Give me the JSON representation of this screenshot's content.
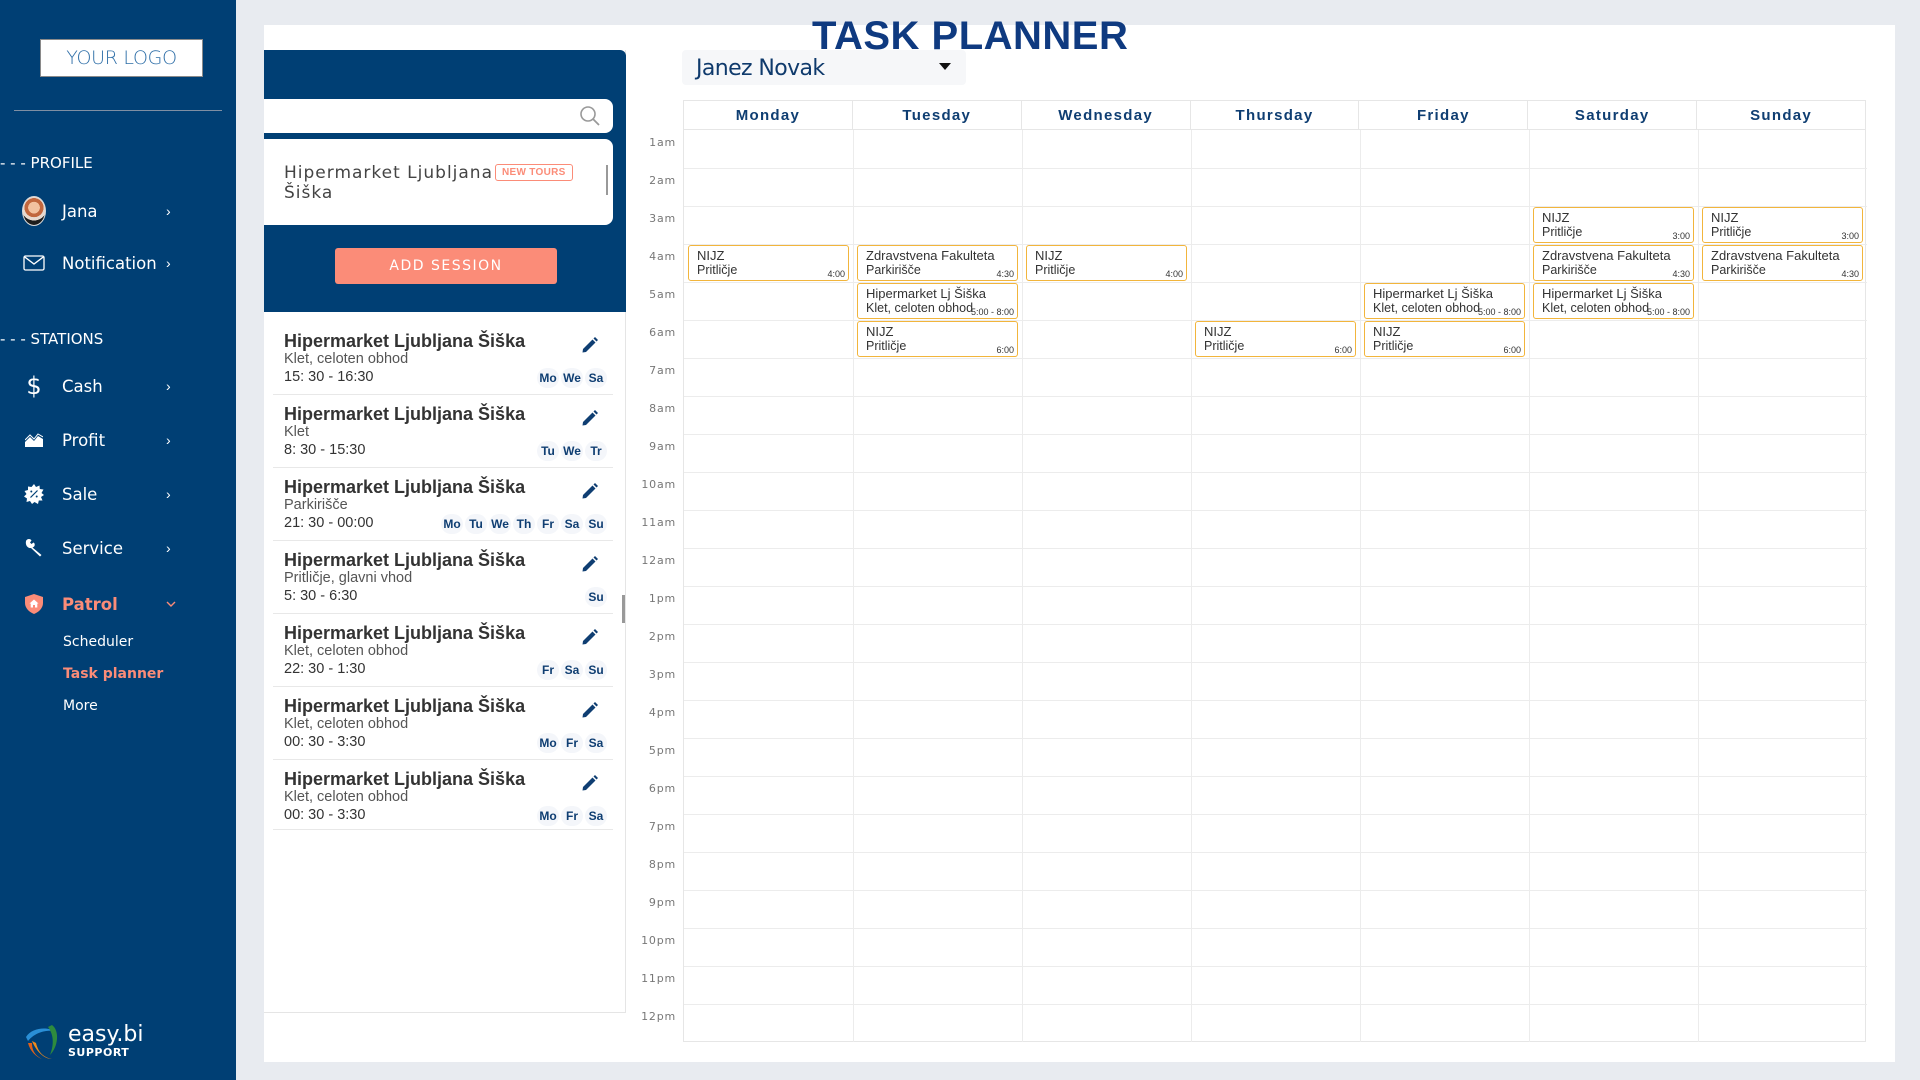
{
  "sidebar": {
    "logo": "YOUR LOGO",
    "profile_section": "- - -  PROFILE",
    "stations_section": "- - -  STATIONS",
    "profile_items": [
      {
        "label": "Jana",
        "icon": "avatar"
      },
      {
        "label": "Notification",
        "icon": "envelope-icon"
      }
    ],
    "station_items": [
      {
        "label": "Cash",
        "icon": "dollar-icon"
      },
      {
        "label": "Profit",
        "icon": "chart-area-icon"
      },
      {
        "label": "Sale",
        "icon": "sale-badge-icon"
      },
      {
        "label": "Service",
        "icon": "wrench-icon"
      },
      {
        "label": "Patrol",
        "icon": "shield-home-icon",
        "active": true
      }
    ],
    "patrol_sub": [
      {
        "label": "Scheduler"
      },
      {
        "label": "Task planner",
        "active": true
      },
      {
        "label": "More"
      }
    ],
    "brand": {
      "name": "easy.bi",
      "tag": "SUPPORT"
    },
    "chevron": "›",
    "chevron_down": "⌄"
  },
  "page": {
    "title": "TASK PLANNER",
    "accent_color": "#fb8c78",
    "primary_color": "#003f74"
  },
  "left_panel": {
    "search_placeholder": "",
    "location": {
      "name": "Hipermarket Ljubljana Šiška",
      "badge": "NEW TOURS"
    },
    "add_session_label": "ADD SESSION",
    "tasks": [
      {
        "title": "Hipermarket Ljubljana Šiška",
        "sub": "Klet, celoten obhod",
        "time": "15: 30 - 16:30",
        "days": [
          "Mo",
          "We",
          "Sa"
        ]
      },
      {
        "title": "Hipermarket Ljubljana Šiška",
        "sub": "Klet",
        "time": "8: 30 - 15:30",
        "days": [
          "Tu",
          "We",
          "Tr"
        ]
      },
      {
        "title": "Hipermarket Ljubljana Šiška",
        "sub": "Parkirišče",
        "time": "21: 30 - 00:00",
        "days": [
          "Mo",
          "Tu",
          "We",
          "Th",
          "Fr",
          "Sa",
          "Su"
        ]
      },
      {
        "title": "Hipermarket Ljubljana Šiška",
        "sub": "Pritličje, glavni vhod",
        "time": "5: 30 - 6:30",
        "days": [
          "Su"
        ]
      },
      {
        "title": "Hipermarket Ljubljana Šiška",
        "sub": "Klet, celoten obhod",
        "time": "22: 30 - 1:30",
        "days": [
          "Fr",
          "Sa",
          "Su"
        ]
      },
      {
        "title": "Hipermarket Ljubljana Šiška",
        "sub": "Klet, celoten obhod",
        "time": "00: 30 - 3:30",
        "days": [
          "Mo",
          "Fr",
          "Sa"
        ]
      },
      {
        "title": "Hipermarket Ljubljana Šiška",
        "sub": "Klet, celoten obhod",
        "time": "00: 30 - 3:30",
        "days": [
          "Mo",
          "Fr",
          "Sa"
        ]
      }
    ]
  },
  "calendar": {
    "user": "Janez Novak",
    "days": [
      "Monday",
      "Tuesday",
      "Wednesday",
      "Thursday",
      "Friday",
      "Saturday",
      "Sunday"
    ],
    "hours": [
      "1am",
      "2am",
      "3am",
      "4am",
      "5am",
      "6am",
      "7am",
      "8am",
      "9am",
      "10am",
      "11am",
      "12am",
      "1pm",
      "2pm",
      "3pm",
      "4pm",
      "5pm",
      "6pm",
      "7pm",
      "8pm",
      "9pm",
      "10pm",
      "11pm",
      "12pm"
    ],
    "events": [
      {
        "day": 0,
        "row": 3,
        "title": "NIJZ",
        "sub": "Pritličje",
        "time": "4:00"
      },
      {
        "day": 1,
        "row": 3,
        "title": "Zdravstvena Fakulteta",
        "sub": "Parkirišče",
        "time": "4:30"
      },
      {
        "day": 1,
        "row": 4,
        "title": "Hipermarket Lj Šiška",
        "sub": "Klet, celoten obhod",
        "time": "5:00 - 8:00"
      },
      {
        "day": 1,
        "row": 5,
        "title": "NIJZ",
        "sub": "Pritličje",
        "time": "6:00"
      },
      {
        "day": 2,
        "row": 3,
        "title": "NIJZ",
        "sub": "Pritličje",
        "time": "4:00"
      },
      {
        "day": 3,
        "row": 5,
        "title": "NIJZ",
        "sub": "Pritličje",
        "time": "6:00"
      },
      {
        "day": 4,
        "row": 4,
        "title": "Hipermarket Lj Šiška",
        "sub": "Klet, celoten obhod",
        "time": "5:00 - 8:00"
      },
      {
        "day": 4,
        "row": 5,
        "title": "NIJZ",
        "sub": "Pritličje",
        "time": "6:00"
      },
      {
        "day": 5,
        "row": 2,
        "title": "NIJZ",
        "sub": "Pritličje",
        "time": "3:00"
      },
      {
        "day": 5,
        "row": 3,
        "title": "Zdravstvena Fakulteta",
        "sub": "Parkirišče",
        "time": "4:30"
      },
      {
        "day": 5,
        "row": 4,
        "title": "Hipermarket Lj Šiška",
        "sub": "Klet, celoten obhod",
        "time": "5:00 - 8:00"
      },
      {
        "day": 6,
        "row": 2,
        "title": "NIJZ",
        "sub": "Pritličje",
        "time": "3:00"
      },
      {
        "day": 6,
        "row": 3,
        "title": "Zdravstvena Fakulteta",
        "sub": "Parkirišče",
        "time": "4:30"
      }
    ]
  }
}
